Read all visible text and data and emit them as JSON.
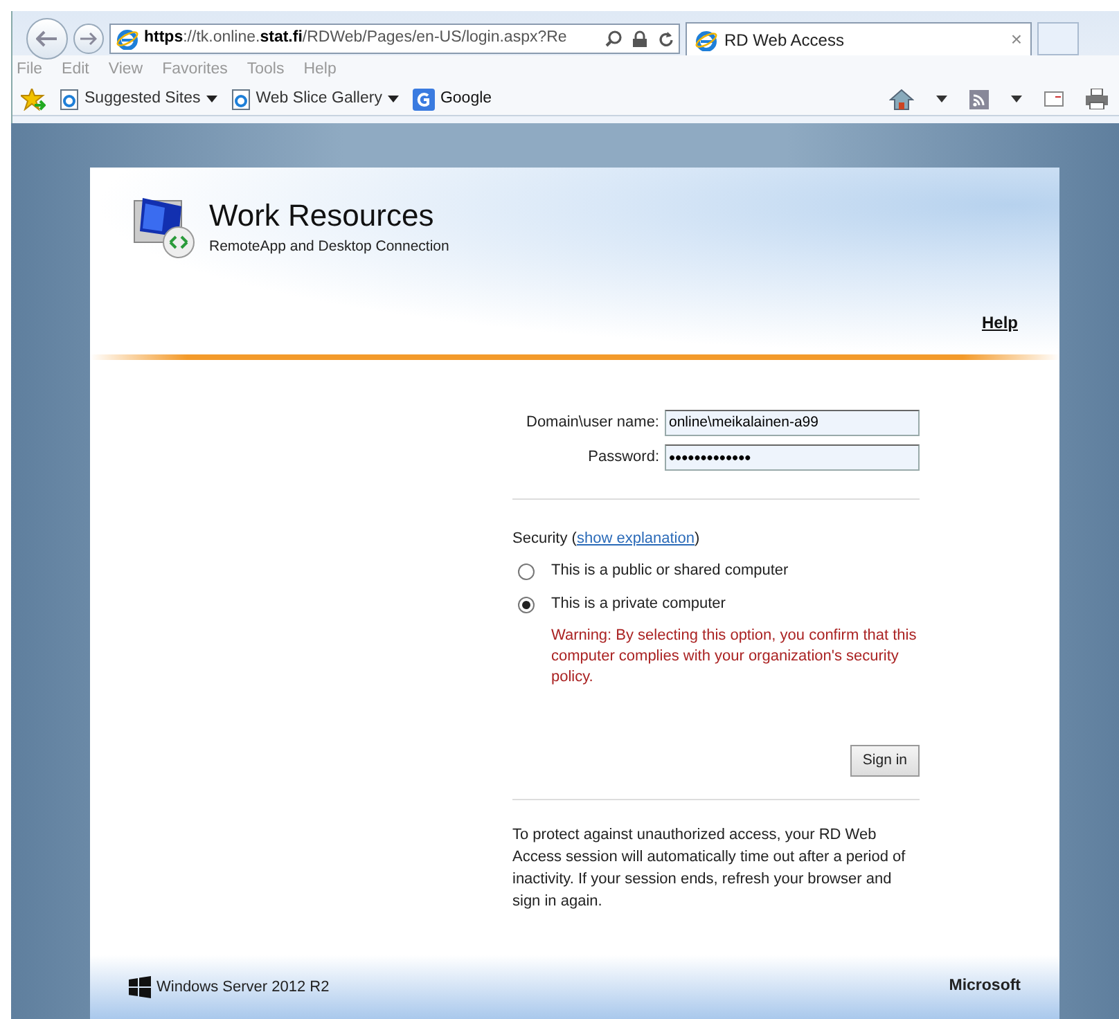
{
  "browser": {
    "address": "**https**://tk.online.**stat.fi**/RDWeb/Pages/en-US/login.aspx?Re",
    "tab": {
      "title": "RD Web Access",
      "close": "×",
      "selected": true
    },
    "menu": [
      "File",
      "Edit",
      "View",
      "Favorites",
      "Tools",
      "Help"
    ],
    "favorites": [
      {
        "label": "Suggested Sites",
        "dropdown": true,
        "kind": "ie"
      },
      {
        "label": "Web Slice Gallery",
        "dropdown": true,
        "kind": "ie"
      },
      {
        "label": "Google",
        "dropdown": false,
        "kind": "google"
      }
    ]
  },
  "page": {
    "title": "Work Resources",
    "subtitle": "RemoteApp and Desktop Connection",
    "help": "Help",
    "fields": [
      {
        "label": "Domain\\user name:",
        "value": "online\\meikalainen-a99"
      },
      {
        "label": "Password:",
        "value": "•••••••••••••"
      }
    ],
    "security": {
      "label": "Security (",
      "link": "show explanation",
      "close": ")"
    },
    "options": [
      {
        "label": "This is a public or shared computer",
        "selected": false
      },
      {
        "label": "This is a private computer",
        "selected": true
      }
    ],
    "warning": "Warning: By selecting this option, you confirm that this computer complies with your organization's security policy.",
    "button": "Sign in",
    "notice": "To protect against unauthorized access, your RD Web Access session will automatically time out after a period of inactivity. If your session ends, refresh your browser and sign in again.",
    "footer_left": "Windows Server 2012 R2",
    "footer_right": "Microsoft"
  }
}
